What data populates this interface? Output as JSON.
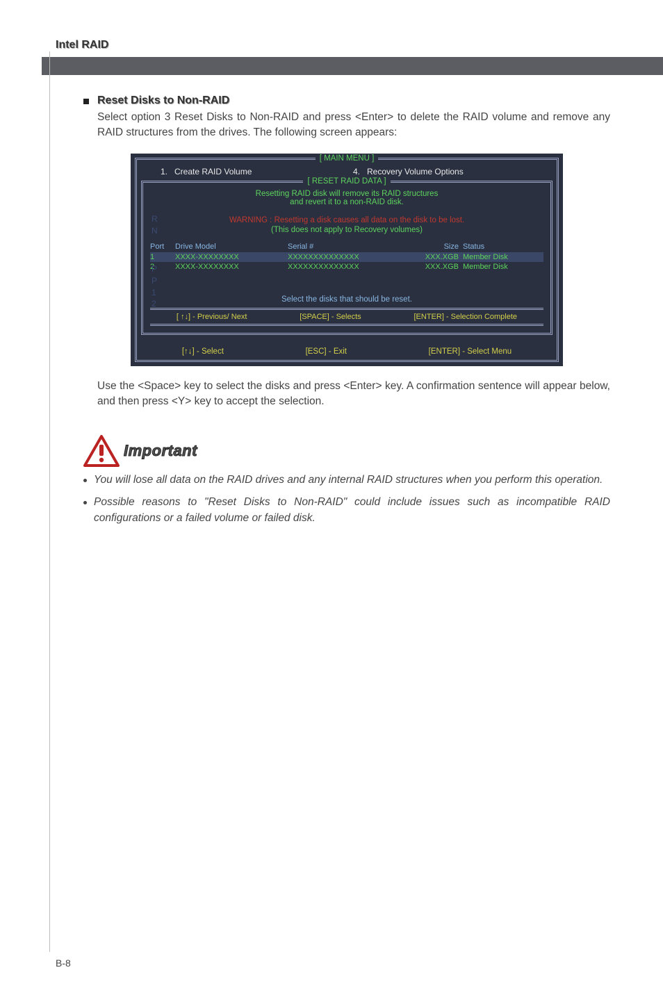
{
  "header": {
    "title": "Intel RAID"
  },
  "section": {
    "heading": "Reset Disks to Non-RAID",
    "intro": "Select option 3 Reset Disks to Non-RAID and press <Enter> to delete the RAID volume and remove any RAID structures from the drives. The following screen appears:"
  },
  "bios": {
    "main_menu_label": "[   MAIN  MENU   ]",
    "menu": {
      "item1_num": "1.",
      "item1": "Create  RAID  Volume",
      "item4_num": "4.",
      "item4": "Recovery Volume  Options"
    },
    "reset_label": "[ RESET  RAID  DATA ]",
    "line1": "Resetting  RAID  disk  will  remove  its  RAID  structures",
    "line2": "and  revert  it  to  a  non-RAID  disk.",
    "warning": "WARNING : Resetting  a  disk  causes  all  data  on  the  disk  to  be  lost.",
    "line3": "(This  does  not  apply  to  Recovery  volumes)",
    "columns": {
      "port": "Port",
      "model": "Drive  Model",
      "serial": "Serial  #",
      "size": "Size",
      "status": "Status"
    },
    "rows": [
      {
        "port": "1",
        "model": "XXXX-XXXXXXXX",
        "serial": "XXXXXXXXXXXXXX",
        "size": "XXX.XGB",
        "status": "Member Disk"
      },
      {
        "port": "2",
        "model": "XXXX-XXXXXXXX",
        "serial": "XXXXXXXXXXXXXX",
        "size": "XXX.XGB",
        "status": "Member Disk"
      }
    ],
    "instr": "Select  the  disks  that  should  be  reset.",
    "hints": {
      "prev": "[ ↑↓] - Previous/ Next",
      "space": "[SPACE] - Selects",
      "enter": "[ENTER] - Selection Complete"
    },
    "bottom": {
      "select": "[↑↓] - Select",
      "esc": "[ESC] - Exit",
      "menu": "[ENTER] - Select Menu"
    }
  },
  "post_text": "Use the <Space> key to select the disks and press <Enter> key. A confirmation sentence will appear below, and then press <Y> key to accept the selection.",
  "important_label": "Important",
  "notes": [
    "You will lose all data on the RAID drives and any internal RAID structures when you perform this operation.",
    "Possible reasons to \"Reset Disks to Non-RAID\" could include issues such as incompatible RAID configurations or a failed volume or failed disk."
  ],
  "page_number": "B-8"
}
